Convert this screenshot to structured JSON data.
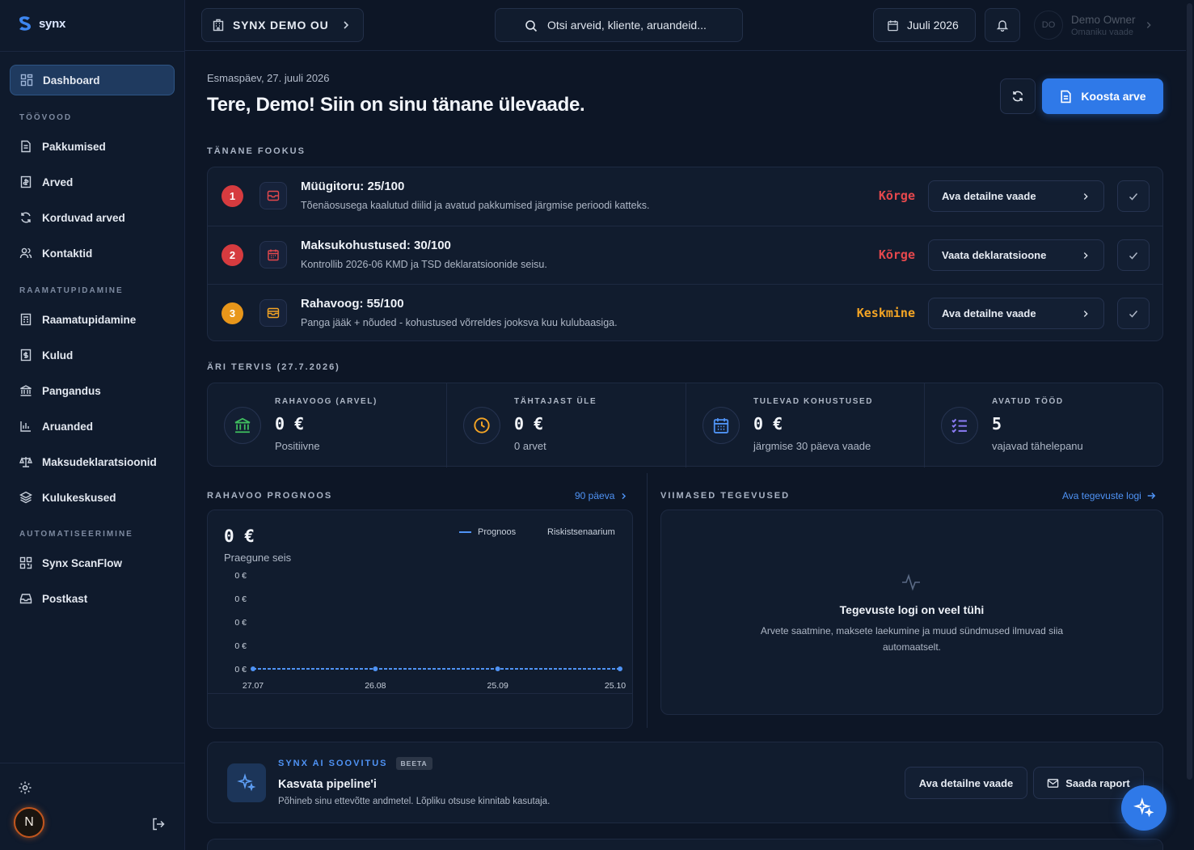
{
  "brand": {
    "name": "synx"
  },
  "sidebar": {
    "dashboard": "Dashboard",
    "sections": [
      {
        "label": "TÖÖVOOD",
        "items": [
          "Pakkumised",
          "Arved",
          "Korduvad arved",
          "Kontaktid"
        ]
      },
      {
        "label": "RAAMATUPIDAMINE",
        "items": [
          "Raamatupidamine",
          "Kulud",
          "Pangandus",
          "Aruanded",
          "Maksudeklaratsioonid",
          "Kulukeskused"
        ]
      },
      {
        "label": "AUTOMATISEERIMINE",
        "items": [
          "Synx ScanFlow",
          "Postkast"
        ]
      }
    ],
    "avatar_initial": "N"
  },
  "topbar": {
    "company": "SYNX DEMO OU",
    "search_placeholder": "Otsi arveid, kliente, aruandeid...",
    "period": "Juuli 2026",
    "user_initials": "DO",
    "user_name": "Demo Owner",
    "user_role": "Omaniku vaade"
  },
  "header": {
    "date": "Esmaspäev, 27. juuli 2026",
    "greeting": "Tere, Demo! Siin on sinu tänane ülevaade.",
    "create_invoice": "Koosta arve"
  },
  "focus": {
    "title": "TÄNANE FOOKUS",
    "colors": {
      "high": "#e5484d",
      "medium": "#f5a524"
    },
    "items": [
      {
        "rank": "1",
        "title": "Müügitoru: 25/100",
        "desc": "Tõenäosusega kaalutud diilid ja avatud pakkumised järgmise perioodi katteks.",
        "priority": "Kõrge",
        "level": "high",
        "action": "Ava detailne vaade",
        "icon": "inbox-icon"
      },
      {
        "rank": "2",
        "title": "Maksukohustused: 30/100",
        "desc": "Kontrollib 2026-06 KMD ja TSD deklaratsioonide seisu.",
        "priority": "Kõrge",
        "level": "high",
        "action": "Vaata deklaratsioone",
        "icon": "calendar-icon"
      },
      {
        "rank": "3",
        "title": "Rahavoog: 55/100",
        "desc": "Panga jääk + nõuded - kohustused võrreldes jooksva kuu kulubaasiga.",
        "priority": "Keskmine",
        "level": "medium",
        "action": "Ava detailne vaade",
        "icon": "wallet-icon"
      }
    ]
  },
  "health": {
    "title": "ÄRI TERVIS (27.7.2026)",
    "kpis": [
      {
        "label": "RAHAVOOG (ARVEL)",
        "value": "0 €",
        "sub": "Positiivne",
        "icon": "bank-icon",
        "color": "#3fbf5f"
      },
      {
        "label": "TÄHTAJAST ÜLE",
        "value": "0 €",
        "sub": "0 arvet",
        "icon": "clock-icon",
        "color": "#f5a524"
      },
      {
        "label": "TULEVAD KOHUSTUSED",
        "value": "0 €",
        "sub": "järgmise 30 päeva vaade",
        "icon": "calendar-icon",
        "color": "#4f93f5"
      },
      {
        "label": "AVATUD TÖÖD",
        "value": "5",
        "sub": "vajavad tähelepanu",
        "icon": "checklist-icon",
        "color": "#8b7cf6"
      }
    ]
  },
  "forecast": {
    "title": "RAHAVOO PROGNOOS",
    "range_link": "90 päeva",
    "value": "0 €",
    "sub": "Praegune seis"
  },
  "chart_data": {
    "type": "line",
    "x": [
      "27.07",
      "26.08",
      "25.09",
      "25.10"
    ],
    "series": [
      {
        "name": "Prognoos",
        "values": [
          0,
          0,
          0,
          0
        ],
        "color": "#4f93f5"
      },
      {
        "name": "Riskistsenaarium",
        "values": [],
        "color": "#c8d0dc"
      }
    ],
    "y_ticks": [
      "0 €",
      "0 €",
      "0 €",
      "0 €",
      "0 €"
    ],
    "grid": false
  },
  "activity": {
    "title": "VIIMASED TEGEVUSED",
    "link": "Ava tegevuste logi",
    "empty_title": "Tegevuste logi on veel tühi",
    "empty_desc": "Arvete saatmine, maksete laekumine ja muud sündmused ilmuvad siia automaatselt."
  },
  "ai": {
    "label": "SYNX AI SOOVITUS",
    "badge": "BEETA",
    "title": "Kasvata pipeline'i",
    "desc": "Põhineb sinu ettevõtte andmetel. Lõpliku otsuse kinnitab kasutaja.",
    "detail_btn": "Ava detailne vaade",
    "report_btn": "Saada raport"
  }
}
